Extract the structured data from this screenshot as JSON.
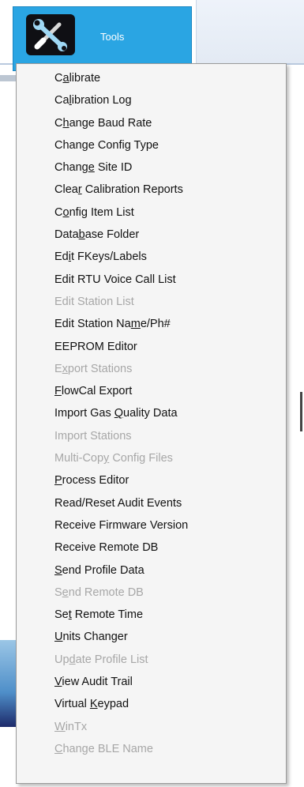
{
  "tools_button": {
    "label": "Tools",
    "icon": "wrench-screwdriver-icon"
  },
  "colors": {
    "button_bg": "#2aa5e3",
    "menu_bg": "#f5f5f5",
    "text": "#111111",
    "disabled_text": "#a7a7a7"
  },
  "menu": {
    "items": [
      {
        "label": "Calibrate",
        "mnemonic_index": 1,
        "enabled": true
      },
      {
        "label": "Calibration Log",
        "mnemonic_index": 2,
        "enabled": true
      },
      {
        "label": "Change Baud Rate",
        "mnemonic_index": 1,
        "enabled": true
      },
      {
        "label": "Change Config Type",
        "mnemonic_index": 4,
        "enabled": true
      },
      {
        "label": "Change Site ID",
        "mnemonic_index": 5,
        "enabled": true
      },
      {
        "label": "Clear Calibration Reports",
        "mnemonic_index": 4,
        "enabled": true
      },
      {
        "label": "Config Item List",
        "mnemonic_index": 1,
        "enabled": true
      },
      {
        "label": "Database Folder",
        "mnemonic_index": 4,
        "enabled": true
      },
      {
        "label": "Edit FKeys/Labels",
        "mnemonic_index": 2,
        "enabled": true
      },
      {
        "label": "Edit RTU Voice Call List",
        "mnemonic_index": -1,
        "enabled": true
      },
      {
        "label": "Edit Station List",
        "mnemonic_index": -1,
        "enabled": false
      },
      {
        "label": "Edit Station Name/Ph#",
        "mnemonic_index": 15,
        "enabled": true
      },
      {
        "label": "EEPROM Editor",
        "mnemonic_index": -1,
        "enabled": true
      },
      {
        "label": "Export Stations",
        "mnemonic_index": 1,
        "enabled": false
      },
      {
        "label": "FlowCal Export",
        "mnemonic_index": 0,
        "enabled": true
      },
      {
        "label": "Import Gas Quality Data",
        "mnemonic_index": 11,
        "enabled": true
      },
      {
        "label": "Import Stations",
        "mnemonic_index": -1,
        "enabled": false
      },
      {
        "label": "Multi-Copy Config Files",
        "mnemonic_index": 9,
        "enabled": false
      },
      {
        "label": "Process Editor",
        "mnemonic_index": 0,
        "enabled": true
      },
      {
        "label": "Read/Reset Audit Events",
        "mnemonic_index": -1,
        "enabled": true
      },
      {
        "label": "Receive Firmware Version",
        "mnemonic_index": -1,
        "enabled": true
      },
      {
        "label": "Receive Remote DB",
        "mnemonic_index": -1,
        "enabled": true
      },
      {
        "label": "Send Profile Data",
        "mnemonic_index": 0,
        "enabled": true
      },
      {
        "label": "Send Remote DB",
        "mnemonic_index": 1,
        "enabled": false
      },
      {
        "label": "Set Remote Time",
        "mnemonic_index": 2,
        "enabled": true
      },
      {
        "label": "Units Changer",
        "mnemonic_index": 0,
        "enabled": true
      },
      {
        "label": "Update Profile List",
        "mnemonic_index": 2,
        "enabled": false
      },
      {
        "label": "View Audit Trail",
        "mnemonic_index": 0,
        "enabled": true
      },
      {
        "label": "Virtual Keypad",
        "mnemonic_index": 8,
        "enabled": true
      },
      {
        "label": "WinTx",
        "mnemonic_index": 0,
        "enabled": false
      },
      {
        "label": "Change BLE Name",
        "mnemonic_index": 0,
        "enabled": false
      }
    ]
  }
}
